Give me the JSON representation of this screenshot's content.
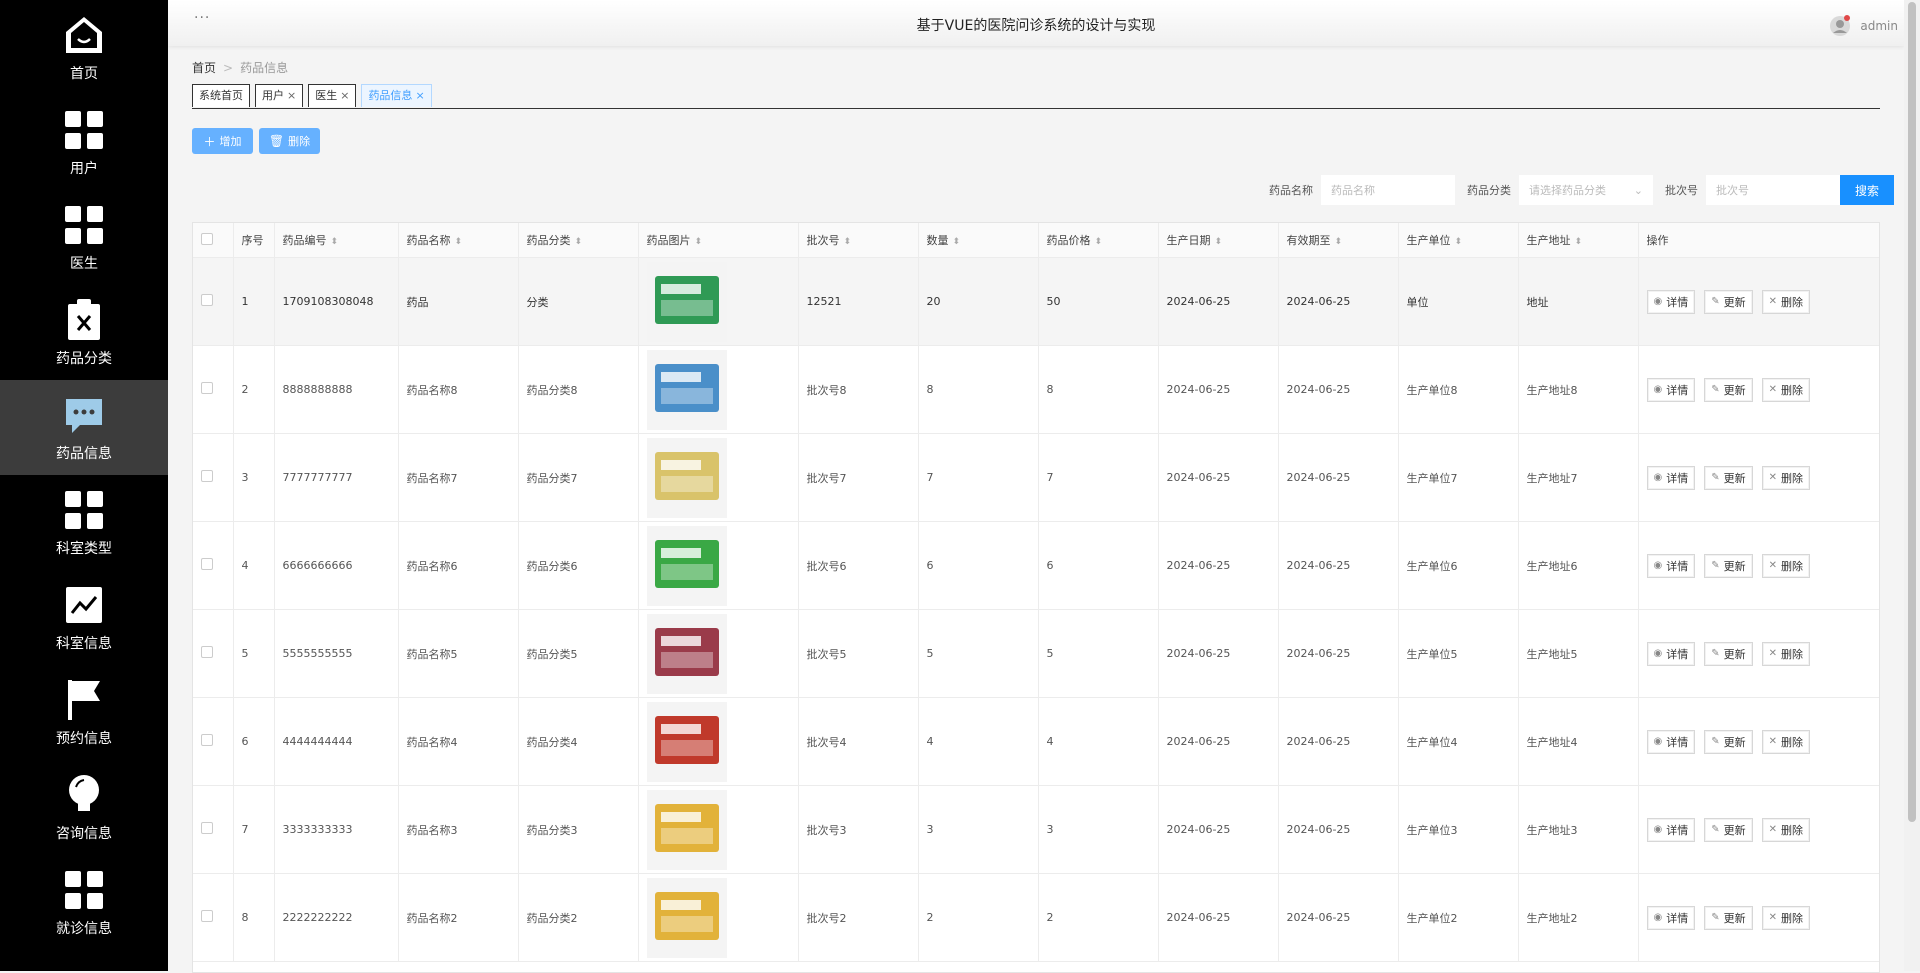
{
  "header": {
    "title": "基于VUE的医院问诊系统的设计与实现",
    "user": "admin",
    "dots": "···"
  },
  "sidebar": {
    "items": [
      {
        "label": "首页",
        "icon": "home-icon"
      },
      {
        "label": "用户",
        "icon": "grid-icon"
      },
      {
        "label": "医生",
        "icon": "grid-icon"
      },
      {
        "label": "药品分类",
        "icon": "clipboard-x-icon"
      },
      {
        "label": "药品信息",
        "icon": "chat-icon",
        "active": true
      },
      {
        "label": "科室类型",
        "icon": "grid-icon"
      },
      {
        "label": "科室信息",
        "icon": "trend-chart-icon"
      },
      {
        "label": "预约信息",
        "icon": "flag-icon"
      },
      {
        "label": "咨询信息",
        "icon": "bulb-icon"
      },
      {
        "label": "就诊信息",
        "icon": "grid-icon"
      }
    ]
  },
  "breadcrumb": {
    "home": "首页",
    "sep": ">",
    "current": "药品信息"
  },
  "tabs": [
    {
      "label": "系统首页",
      "closable": false
    },
    {
      "label": "用户",
      "closable": true
    },
    {
      "label": "医生",
      "closable": true
    },
    {
      "label": "药品信息",
      "closable": true,
      "active": true
    }
  ],
  "actions": {
    "add": "增加",
    "delete": "删除"
  },
  "search": {
    "name_label": "药品名称",
    "name_placeholder": "药品名称",
    "category_label": "药品分类",
    "category_placeholder": "请选择药品分类",
    "batch_label": "批次号",
    "batch_placeholder": "批次号",
    "button": "搜索"
  },
  "table": {
    "columns": [
      "序号",
      "药品编号",
      "药品名称",
      "药品分类",
      "药品图片",
      "批次号",
      "数量",
      "药品价格",
      "生产日期",
      "有效期至",
      "生产单位",
      "生产地址",
      "操作"
    ],
    "ops": {
      "detail": "详情",
      "update": "更新",
      "delete": "删除"
    },
    "rows": [
      {
        "idx": "1",
        "code": "1709108308048",
        "name": "药品",
        "category": "分类",
        "batch": "12521",
        "qty": "20",
        "price": "50",
        "mfg": "2024-06-25",
        "exp": "2024-06-25",
        "unit": "单位",
        "addr": "地址",
        "img_color": "#2f9a55"
      },
      {
        "idx": "2",
        "code": "8888888888",
        "name": "药品名称8",
        "category": "药品分类8",
        "batch": "批次号8",
        "qty": "8",
        "price": "8",
        "mfg": "2024-06-25",
        "exp": "2024-06-25",
        "unit": "生产单位8",
        "addr": "生产地址8",
        "img_color": "#4a8fc9"
      },
      {
        "idx": "3",
        "code": "7777777777",
        "name": "药品名称7",
        "category": "药品分类7",
        "batch": "批次号7",
        "qty": "7",
        "price": "7",
        "mfg": "2024-06-25",
        "exp": "2024-06-25",
        "unit": "生产单位7",
        "addr": "生产地址7",
        "img_color": "#d9c36a"
      },
      {
        "idx": "4",
        "code": "6666666666",
        "name": "药品名称6",
        "category": "药品分类6",
        "batch": "批次号6",
        "qty": "6",
        "price": "6",
        "mfg": "2024-06-25",
        "exp": "2024-06-25",
        "unit": "生产单位6",
        "addr": "生产地址6",
        "img_color": "#3aa845"
      },
      {
        "idx": "5",
        "code": "5555555555",
        "name": "药品名称5",
        "category": "药品分类5",
        "batch": "批次号5",
        "qty": "5",
        "price": "5",
        "mfg": "2024-06-25",
        "exp": "2024-06-25",
        "unit": "生产单位5",
        "addr": "生产地址5",
        "img_color": "#9a3b4a"
      },
      {
        "idx": "6",
        "code": "4444444444",
        "name": "药品名称4",
        "category": "药品分类4",
        "batch": "批次号4",
        "qty": "4",
        "price": "4",
        "mfg": "2024-06-25",
        "exp": "2024-06-25",
        "unit": "生产单位4",
        "addr": "生产地址4",
        "img_color": "#c0392b"
      },
      {
        "idx": "7",
        "code": "3333333333",
        "name": "药品名称3",
        "category": "药品分类3",
        "batch": "批次号3",
        "qty": "3",
        "price": "3",
        "mfg": "2024-06-25",
        "exp": "2024-06-25",
        "unit": "生产单位3",
        "addr": "生产地址3",
        "img_color": "#e2b23a"
      },
      {
        "idx": "8",
        "code": "2222222222",
        "name": "药品名称2",
        "category": "药品分类2",
        "batch": "批次号2",
        "qty": "2",
        "price": "2",
        "mfg": "2024-06-25",
        "exp": "2024-06-25",
        "unit": "生产单位2",
        "addr": "生产地址2",
        "img_color": "#e2b23a"
      }
    ]
  }
}
